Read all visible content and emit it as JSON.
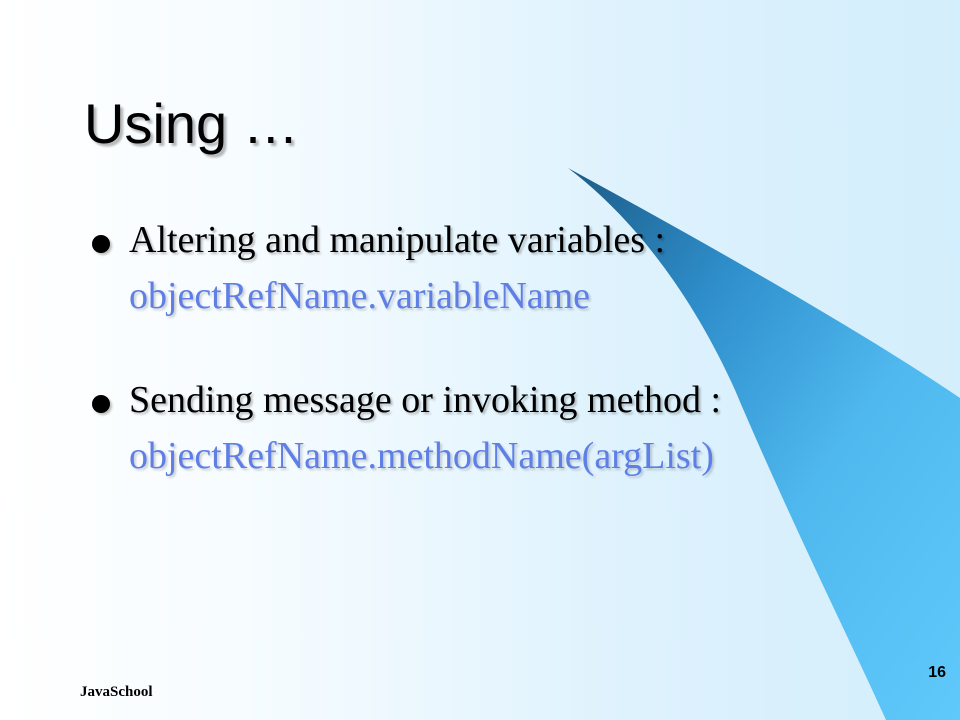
{
  "slide": {
    "title": "Using …",
    "bullets": [
      {
        "text": "Altering and manipulate variables :",
        "code": "objectRefName.variableName"
      },
      {
        "text": "Sending message or invoking method :",
        "code": "objectRefName.methodName(argList)"
      }
    ],
    "footer": "JavaSchool",
    "page_number": "16"
  },
  "colors": {
    "code_text": "#5f7fe6",
    "swoosh_blue": "#5ac8fa",
    "swoosh_dark": "#1a5e8a"
  }
}
